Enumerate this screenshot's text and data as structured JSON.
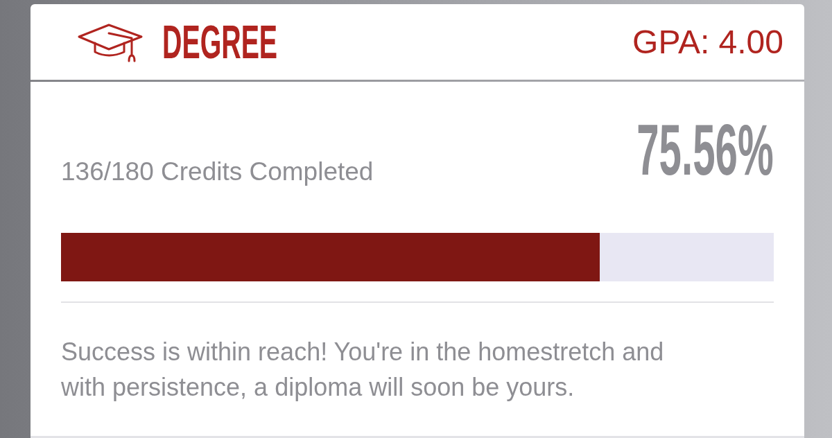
{
  "header": {
    "title": "DEGREE",
    "gpa": "GPA: 4.00"
  },
  "progress": {
    "credits": "136/180 Credits Completed",
    "percent": "75.56%",
    "level": 0.7556
  },
  "message": "Success is within reach! You're in the homestretch and with persistence, a diploma will soon be yours."
}
